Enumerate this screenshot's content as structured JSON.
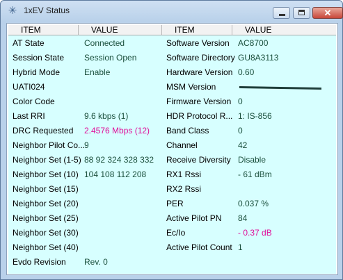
{
  "window": {
    "title": "1xEV Status",
    "icon": "asterisk-icon",
    "minimize_icon": "minimize-icon",
    "maximize_icon": "maximize-icon",
    "close_icon": "close-icon"
  },
  "columns": [
    "ITEM",
    "VALUE",
    "ITEM",
    "VALUE"
  ],
  "left_rows": [
    {
      "item": "AT State",
      "value": "Connected"
    },
    {
      "item": "Session State",
      "value": "Session Open"
    },
    {
      "item": "Hybrid Mode",
      "value": "Enable"
    },
    {
      "item": "UATI024",
      "value": ""
    },
    {
      "item": "Color Code",
      "value": ""
    },
    {
      "item": "Last RRI",
      "value": "9.6 kbps (1)"
    },
    {
      "item": "DRC Requested",
      "value": "2.4576 Mbps (12)",
      "color": "#e0109a"
    },
    {
      "item": "Neighbor Pilot Co...",
      "value": "9"
    },
    {
      "item": "Neighbor Set (1-5)",
      "value": "88 92 324 328 332"
    },
    {
      "item": "Neighbor Set (10)",
      "value": "104 108 112 208"
    },
    {
      "item": "Neighbor Set (15)",
      "value": ""
    },
    {
      "item": "Neighbor Set (20)",
      "value": ""
    },
    {
      "item": "Neighbor Set (25)",
      "value": ""
    },
    {
      "item": "Neighbor Set (30)",
      "value": ""
    },
    {
      "item": "Neighbor Set (40)",
      "value": ""
    },
    {
      "item": "Evdo Revision",
      "value": "Rev. 0"
    }
  ],
  "right_rows": [
    {
      "item": "Software Version",
      "value": "AC8700"
    },
    {
      "item": "Software Directory",
      "value": "GU8A3113"
    },
    {
      "item": "Hardware Version",
      "value": "0.60"
    },
    {
      "item": "MSM Version",
      "value": "",
      "redacted": true
    },
    {
      "item": "Firmware Version",
      "value": "0"
    },
    {
      "item": "HDR Protocol R...",
      "value": "1: IS-856"
    },
    {
      "item": "Band Class",
      "value": "0"
    },
    {
      "item": "Channel",
      "value": "42"
    },
    {
      "item": "Receive Diversity",
      "value": "Disable"
    },
    {
      "item": "RX1 Rssi",
      "value": "- 61 dBm"
    },
    {
      "item": "RX2 Rssi",
      "value": ""
    },
    {
      "item": "PER",
      "value": "0.037 %"
    },
    {
      "item": "Active Pilot PN",
      "value": "84"
    },
    {
      "item": "Ec/Io",
      "value": "- 0.37 dB",
      "color": "#e0109a"
    },
    {
      "item": "Active Pilot Count",
      "value": "1"
    },
    {
      "item": "",
      "value": ""
    }
  ]
}
